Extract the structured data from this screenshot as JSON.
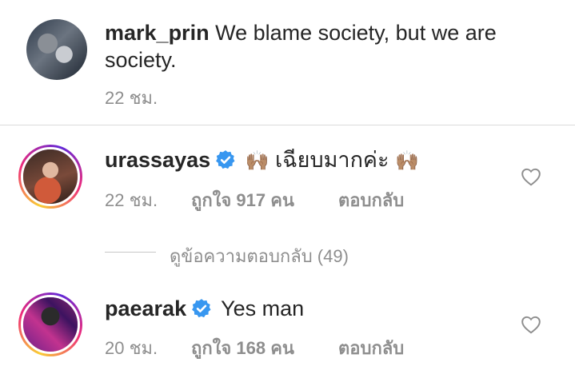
{
  "comments": [
    {
      "username": "mark_prin",
      "text_line1": "We blame society, but we are",
      "text_line2": "society.",
      "time": "22 ชม."
    },
    {
      "username": "urassayas",
      "verified": true,
      "emoji_left": "🙌🏽",
      "text": "เฉียบมากค่ะ",
      "emoji_right": "🙌🏽",
      "time": "22 ชม.",
      "likes": "ถูกใจ 917 คน",
      "reply": "ตอบกลับ"
    },
    {
      "username": "paearak",
      "verified": true,
      "text": "Yes man",
      "time": "20 ชม.",
      "likes": "ถูกใจ 168 คน",
      "reply": "ตอบกลับ"
    }
  ],
  "view_replies": "ดูข้อความตอบกลับ (49)",
  "colors": {
    "verified": "#3897f0",
    "muted": "#8e8e8e",
    "text": "#262626"
  },
  "icons": [
    "heart-outline-icon",
    "verified-badge-icon"
  ]
}
